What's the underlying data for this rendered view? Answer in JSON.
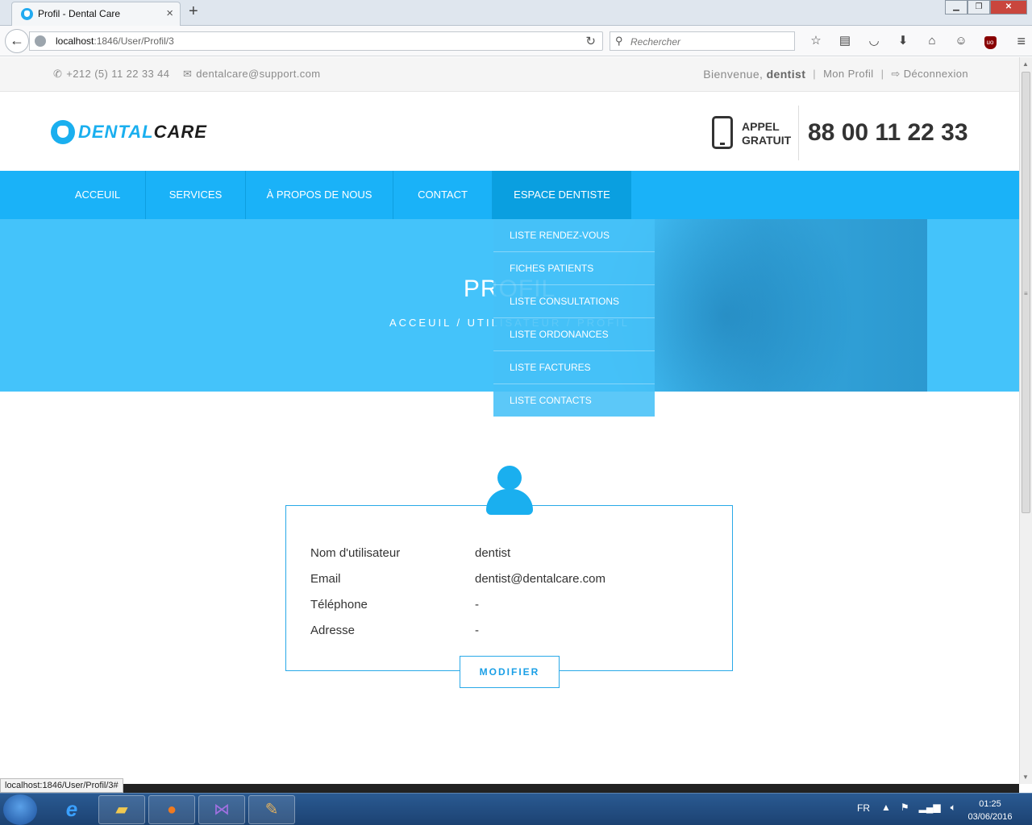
{
  "browser": {
    "tab_title": "Profil - Dental Care",
    "url_host": "localhost",
    "url_path": ":1846/User/Profil/3",
    "search_placeholder": "Rechercher",
    "status_url": "localhost:1846/User/Profil/3#"
  },
  "topbar": {
    "phone": "+212 (5) 11 22 33 44",
    "email": "dentalcare@support.com",
    "welcome": "Bienvenue,",
    "username": "dentist",
    "separator": "|",
    "profile_link": "Mon Profil",
    "logout_link": "Déconnexion"
  },
  "header": {
    "logo_dental": "DENTAL",
    "logo_care": "CARE",
    "call_line1": "APPEL",
    "call_line2": "GRATUIT",
    "call_number": "88 00 11 22 33"
  },
  "nav": {
    "items": [
      {
        "label": "ACCEUIL"
      },
      {
        "label": "SERVICES"
      },
      {
        "label": "À PROPOS DE NOUS"
      },
      {
        "label": "CONTACT"
      },
      {
        "label": "ESPACE DENTISTE"
      }
    ],
    "dropdown": [
      {
        "label": "LISTE RENDEZ-VOUS"
      },
      {
        "label": "FICHES PATIENTS"
      },
      {
        "label": "LISTE CONSULTATIONS"
      },
      {
        "label": "LISTE ORDONANCES"
      },
      {
        "label": "LISTE FACTURES"
      },
      {
        "label": "LISTE CONTACTS"
      }
    ]
  },
  "hero": {
    "title": "PROFIL",
    "breadcrumb": "ACCEUIL  /  UTILISATEUR  /  PROFIL"
  },
  "profile": {
    "rows": [
      {
        "label": "Nom d'utilisateur",
        "value": "dentist"
      },
      {
        "label": "Email",
        "value": "dentist@dentalcare.com"
      },
      {
        "label": "Téléphone",
        "value": "-"
      },
      {
        "label": "Adresse",
        "value": "-"
      }
    ],
    "edit_button": "MODIFIER"
  },
  "taskbar": {
    "language": "FR",
    "time": "01:25",
    "date": "03/06/2016"
  },
  "colors": {
    "accent": "#1ab2f8",
    "hero": "#44c3fa",
    "text": "#333333"
  },
  "icons": [
    "phone-icon",
    "envelope-icon",
    "logout-icon",
    "tooth-logo-icon",
    "mobile-phone-icon",
    "user-avatar-icon"
  ]
}
